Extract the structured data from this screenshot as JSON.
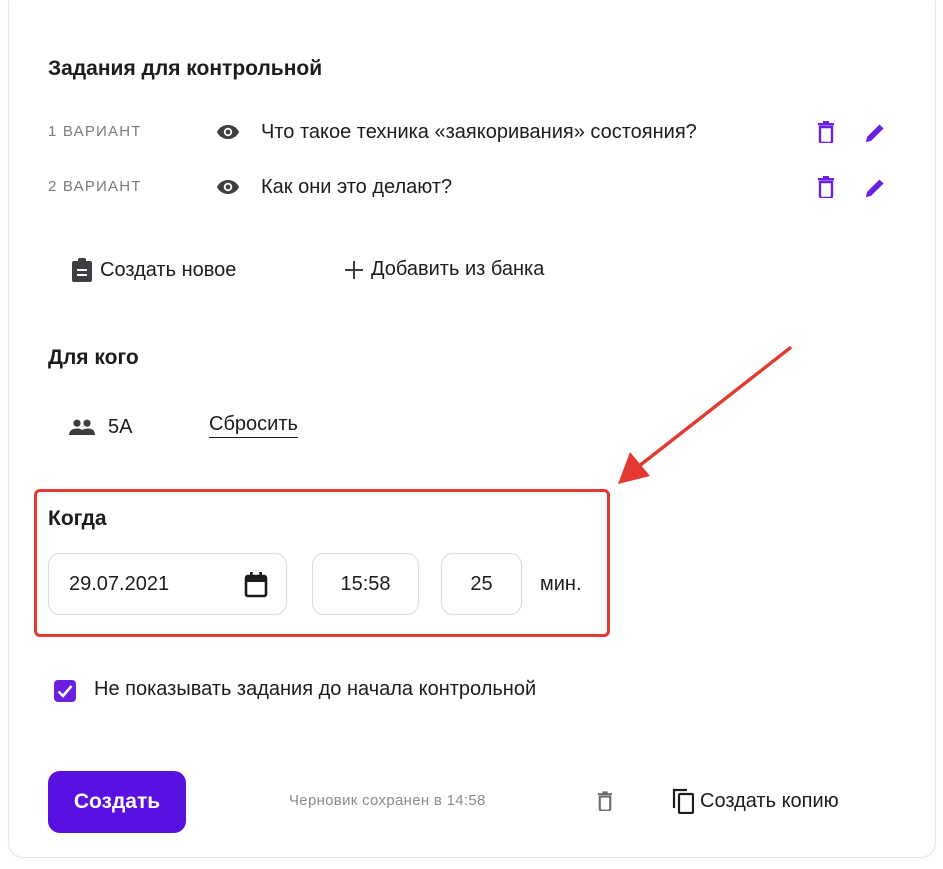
{
  "tasks": {
    "title": "Задания для контрольной",
    "variants": [
      {
        "label": "1 ВАРИАНТ",
        "question": "Что такое техника «заякоривания» состояния?"
      },
      {
        "label": "2 ВАРИАНТ",
        "question": "Как они это делают?"
      }
    ],
    "create_new_label": "Создать новое",
    "add_from_bank_label": "Добавить из банка"
  },
  "audience": {
    "title": "Для кого",
    "group": "5А",
    "reset_label": "Сбросить"
  },
  "when": {
    "title": "Когда",
    "date": "29.07.2021",
    "time": "15:58",
    "duration": "25",
    "duration_unit": "мин."
  },
  "hide_tasks": {
    "checked": true,
    "label": "Не показывать задания до начала контрольной"
  },
  "footer": {
    "create_label": "Создать",
    "draft_status": "Черновик сохранен в 14:58",
    "copy_label": "Создать копию"
  },
  "colors": {
    "accent": "#5a10e0",
    "icon_accent": "#6b1fe0",
    "annotation": "#e23a33",
    "muted_text": "#7a7a80"
  },
  "icons": [
    "eye-icon",
    "trash-icon",
    "pencil-icon",
    "clipboard-icon",
    "plus-icon",
    "people-icon",
    "calendar-icon",
    "check-icon",
    "copy-icon"
  ]
}
